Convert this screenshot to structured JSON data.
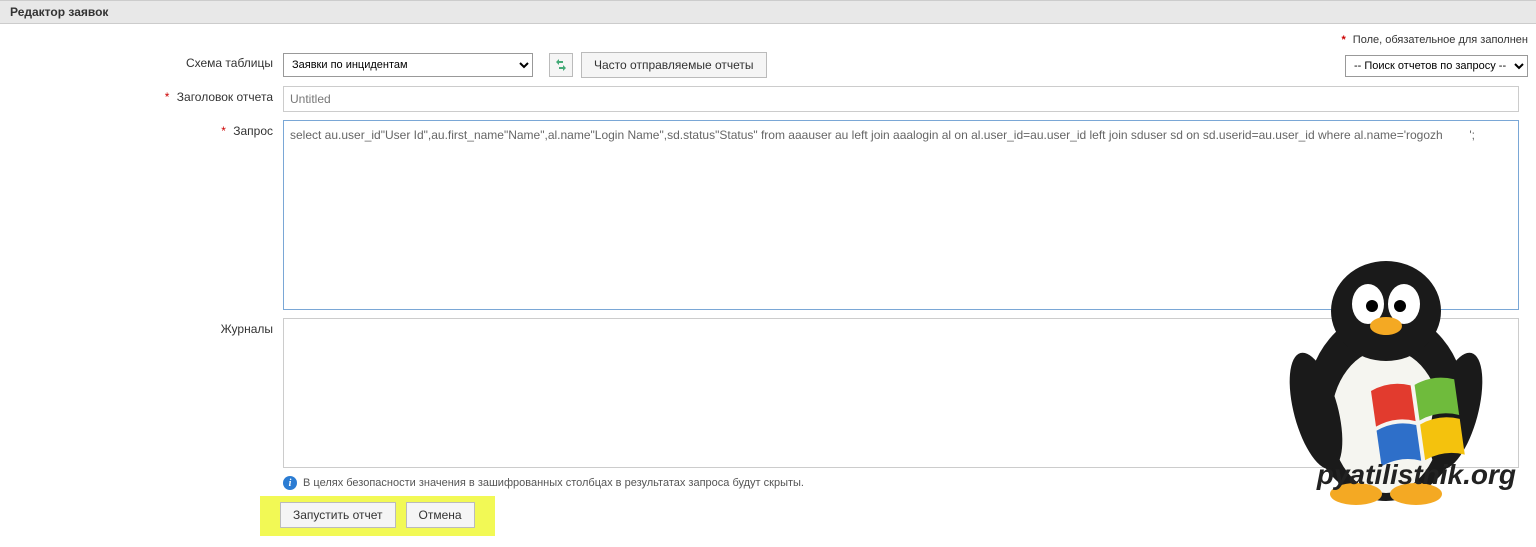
{
  "header": {
    "title": "Редактор заявок"
  },
  "notes": {
    "required": "Поле, обязательное для заполнен"
  },
  "search": {
    "placeholder": "-- Поиск отчетов по запросу --"
  },
  "labels": {
    "schema": "Схема таблицы",
    "title": "Заголовок отчета",
    "query": "Запрос",
    "logs": "Журналы"
  },
  "schema": {
    "selected": "Заявки по инцидентам",
    "frequent_button": "Часто отправляемые отчеты"
  },
  "form": {
    "title_value": "Untitled",
    "query_value": "select au.user_id\"User Id\",au.first_name\"Name\",al.name\"Login Name\",sd.status\"Status\" from aaauser au left join aaalogin al on al.user_id=au.user_id left join sduser sd on sd.userid=au.user_id where al.name='rogozh        ';"
  },
  "info": {
    "security_note": "В целях безопасности значения в зашифрованных столбцах в результатах запроса будут скрыты."
  },
  "actions": {
    "run": "Запустить отчет",
    "cancel": "Отмена"
  },
  "watermark": {
    "text": "pyatilistnik.org"
  }
}
